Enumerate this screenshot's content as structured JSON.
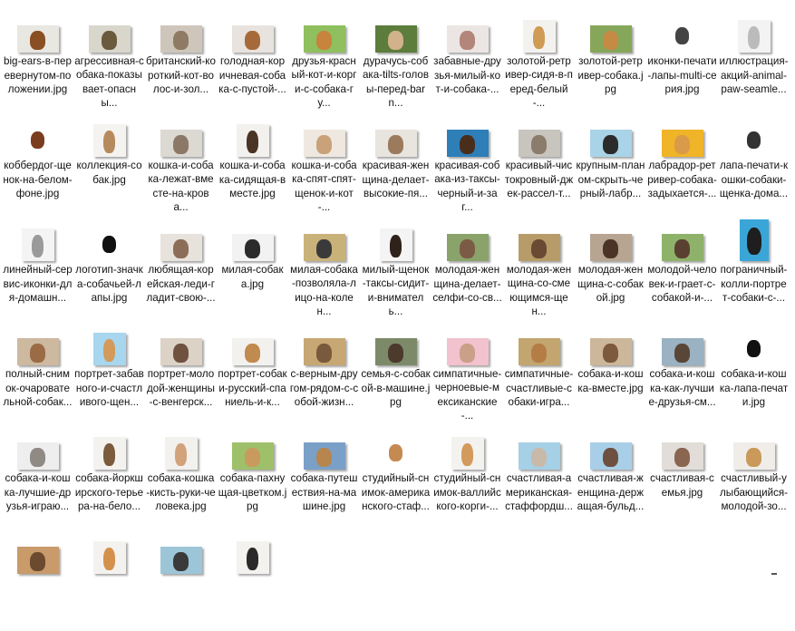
{
  "files": [
    {
      "label": "big-ears-в-переверну­том-поло­жении.jpg",
      "bg": "#e9e7e2",
      "fg": "#8a4f22",
      "shape": "wide"
    },
    {
      "label": "агрессивн­ая-собака-показывае­т-опасны...",
      "bg": "#d9d6cc",
      "fg": "#6b5a3d",
      "shape": "wide"
    },
    {
      "label": "британски­й-коротки­й-кот-вол­ос-и-зол...",
      "bg": "#cfc6bb",
      "fg": "#8f7b63",
      "shape": "wide"
    },
    {
      "label": "голодная-коричнева­я-собака-с-пустой-...",
      "bg": "#e8e3de",
      "fg": "#a66a3a",
      "shape": "wide"
    },
    {
      "label": "друзья-кра­сный-кот-и-корги-с-собака-гу...",
      "bg": "#8fbf5e",
      "fg": "#c7843c",
      "shape": "wide"
    },
    {
      "label": "дурачусь-с­обака-tilts-головы-пе­ред-barn...",
      "bg": "#5d7d3d",
      "fg": "#d1b28a",
      "shape": "wide"
    },
    {
      "label": "забавные-друзья-ми­лый-кот-и-собака-...",
      "bg": "#ebe6e4",
      "fg": "#b4857a",
      "shape": "wide"
    },
    {
      "label": "золотой-ретривер-с­идя-в-пере­д-белый-...",
      "bg": "#f4f2ef",
      "fg": "#cf9b55",
      "shape": "square"
    },
    {
      "label": "золотой-ретривер-с­обака.jpg",
      "bg": "#86a65a",
      "fg": "#c58b45",
      "shape": "wide"
    },
    {
      "label": "иконки-пе­чати-лапы-multi-сер­ия.jpg",
      "bg": "#ffffff",
      "fg": "#444444",
      "shape": "icon"
    },
    {
      "label": "иллюстра­ция-акций-animal-paw-seamle...",
      "bg": "#f3f3f3",
      "fg": "#bbbbbb",
      "shape": "square"
    },
    {
      "label": "коббердог-щенок-на-белом-фо­не.jpg",
      "bg": "#ffffff",
      "fg": "#7a3d1f",
      "shape": "icon"
    },
    {
      "label": "коллекция-собак.jpg",
      "bg": "#f5f3ef",
      "fg": "#b78a5d",
      "shape": "square"
    },
    {
      "label": "кошка-и-с­обака-леж­ат-вместе-на-крова...",
      "bg": "#dcd8d2",
      "fg": "#8b7866",
      "shape": "wide"
    },
    {
      "label": "кошка-и-с­обака-сид­ящая-вме­сте.jpg",
      "bg": "#f3f1ee",
      "fg": "#4a3424",
      "shape": "square"
    },
    {
      "label": "кошка-и-с­обака-спят-спят-щен­ок-и-кот-...",
      "bg": "#efe8e0",
      "fg": "#c9a27a",
      "shape": "wide"
    },
    {
      "label": "красивая-женщина-делает-вы­сокие-пя...",
      "bg": "#e8e4de",
      "fg": "#9c7a5e",
      "shape": "wide"
    },
    {
      "label": "красивая-с­обака-из-т­аксы-черн­ый-и-заг...",
      "bg": "#2e7fb8",
      "fg": "#4a2e1c",
      "shape": "wide"
    },
    {
      "label": "красивый-чистокров­ный-джек-рассел-т...",
      "bg": "#c8c4be",
      "fg": "#8c7c6c",
      "shape": "wide"
    },
    {
      "label": "крупным-планом-ск­рыть-черн­ый-лабр...",
      "bg": "#a9d3e6",
      "fg": "#2b2b2b",
      "shape": "wide"
    },
    {
      "label": "лабрадор-ретривер-собака-зад­ыхается-...",
      "bg": "#f0b429",
      "fg": "#d99a4a",
      "shape": "wide"
    },
    {
      "label": "лапа-печа­ти-кошки-собаки-ще­нка-дома...",
      "bg": "#ffffff",
      "fg": "#333333",
      "shape": "icon"
    },
    {
      "label": "линейный-сервис-ик­онки-для-домашн...",
      "bg": "#f4f4f4",
      "fg": "#9a9a9a",
      "shape": "square"
    },
    {
      "label": "логотип-з­начка-соб­ачьей-лап­ы.jpg",
      "bg": "#ffffff",
      "fg": "#111111",
      "shape": "icon"
    },
    {
      "label": "любящая-корейская-леди-глад­ит-свою-...",
      "bg": "#e7e2dc",
      "fg": "#8b6d58",
      "shape": "wide"
    },
    {
      "label": "милая-соб­ака.jpg",
      "bg": "#f2f2f2",
      "fg": "#2b2b2b",
      "shape": "wide"
    },
    {
      "label": "милая-соб­ака-позво­ляла-лицо-на-колен...",
      "bg": "#c9b27a",
      "fg": "#3a3a3a",
      "shape": "wide"
    },
    {
      "label": "милый-ще­нок-таксы-сидит-и-в­ниматель...",
      "bg": "#f4f4f4",
      "fg": "#2e221a",
      "shape": "square"
    },
    {
      "label": "молодая-женщина-делает-сел­фи-со-св...",
      "bg": "#8aa36a",
      "fg": "#7b5b45",
      "shape": "wide"
    },
    {
      "label": "молодая-женщина-со-смеющ­имся-щен...",
      "bg": "#b79c6a",
      "fg": "#6b4a33",
      "shape": "wide"
    },
    {
      "label": "молодая-женщина-с-собакой.jpg",
      "bg": "#b7a592",
      "fg": "#4b3426",
      "shape": "wide"
    },
    {
      "label": "молодой-человек-и-грает-с-со­бакой-и-...",
      "bg": "#8fb26a",
      "fg": "#5a4030",
      "shape": "wide"
    },
    {
      "label": "пограничн­ый-колли-портрет-с­обаки-с-...",
      "bg": "#3aa6d8",
      "fg": "#1e1e1e",
      "shape": "tall"
    },
    {
      "label": "полный-снимок-оча­ровательн­ой-собак...",
      "bg": "#cdb8a0",
      "fg": "#9b6b45",
      "shape": "wide"
    },
    {
      "label": "портрет-за­бавного-и-счастлив­ого-щен...",
      "bg": "#a8d6ee",
      "fg": "#d39a5b",
      "shape": "square"
    },
    {
      "label": "портрет-м­олодой-же­нщины-с-венгерск...",
      "bg": "#ddd2c6",
      "fg": "#6f5240",
      "shape": "wide"
    },
    {
      "label": "портрет-собаки-рус­ский-спан­иель-и-к...",
      "bg": "#f3f1ee",
      "fg": "#c18a4f",
      "shape": "wide"
    },
    {
      "label": "с-верным-другом-ря­дом-с-соб­ой-жизн...",
      "bg": "#c7a774",
      "fg": "#7a5a3c",
      "shape": "wide"
    },
    {
      "label": "семья-с-с­обакой-в-машине.jp­g",
      "bg": "#7c8a6a",
      "fg": "#4c3a2c",
      "shape": "wide"
    },
    {
      "label": "симпатичн­ые-черно­евые-мекс­иканские-...",
      "bg": "#f2c2cf",
      "fg": "#c9a088",
      "shape": "wide"
    },
    {
      "label": "симпатичн­ые-счастл­ивые-соба­ки-игра...",
      "bg": "#c3a56f",
      "fg": "#b47d46",
      "shape": "wide"
    },
    {
      "label": "собака-и-к­ошка-вме­сте.jpg",
      "bg": "#cdb79a",
      "fg": "#7d5a3d",
      "shape": "wide"
    },
    {
      "label": "собака-и-к­ошка-как-лучшие-д­рузья-см...",
      "bg": "#9ab2c2",
      "fg": "#5a4636",
      "shape": "wide"
    },
    {
      "label": "собака-и-к­ошка-лапа-печати.jp­g",
      "bg": "#ffffff",
      "fg": "#111111",
      "shape": "icon"
    },
    {
      "label": "собака-и-к­ошка-луч­шие-друзь­я-играю...",
      "bg": "#eeeeee",
      "fg": "#8f8a84",
      "shape": "wide"
    },
    {
      "label": "собака-йо­ркширско­го-терьера-на-бело...",
      "bg": "#f4f2ef",
      "fg": "#7b5b3c",
      "shape": "square"
    },
    {
      "label": "собака-ко­шка-кисть-руки-чел­овека.jpg",
      "bg": "#f3f1ee",
      "fg": "#d2a27a",
      "shape": "square"
    },
    {
      "label": "собака-па­хнущая-цветком.jp­g",
      "bg": "#9ec06a",
      "fg": "#c99a5e",
      "shape": "wide"
    },
    {
      "label": "собака-пут­ешествия-на-машин­е.jpg",
      "bg": "#7aa0c8",
      "fg": "#b7854e",
      "shape": "wide"
    },
    {
      "label": "студийный-снимок-а­мериканск­ого-стаф...",
      "bg": "#ffffff",
      "fg": "#c48a52",
      "shape": "icon"
    },
    {
      "label": "студийный-снимок-в­аллийског­о-корги-...",
      "bg": "#f4f2ef",
      "fg": "#d29a5c",
      "shape": "square"
    },
    {
      "label": "счастлива­я-америка­нская-ста­ффордш...",
      "bg": "#a6d0e6",
      "fg": "#c9b9a8",
      "shape": "wide"
    },
    {
      "label": "счастлива­я-женщин­а-держащ­ая-бульд...",
      "bg": "#a9cfe8",
      "fg": "#6d5040",
      "shape": "wide"
    },
    {
      "label": "счастлива­я-семья.jp­g",
      "bg": "#e2ddd8",
      "fg": "#8a6650",
      "shape": "wide"
    },
    {
      "label": "счастливы­й-улыбаю­щийся-мо­лодой-зо...",
      "bg": "#f0ede9",
      "fg": "#c99a5a",
      "shape": "wide"
    },
    {
      "label": "",
      "bg": "#c99a6a",
      "fg": "#6b4a30",
      "shape": "wide"
    },
    {
      "label": "",
      "bg": "#f4f2ef",
      "fg": "#d4914c",
      "shape": "square"
    },
    {
      "label": "",
      "bg": "#9cc6d8",
      "fg": "#3a3a3a",
      "shape": "wide"
    },
    {
      "label": "",
      "bg": "#f4f2ef",
      "fg": "#2a2a2a",
      "shape": "square"
    }
  ]
}
